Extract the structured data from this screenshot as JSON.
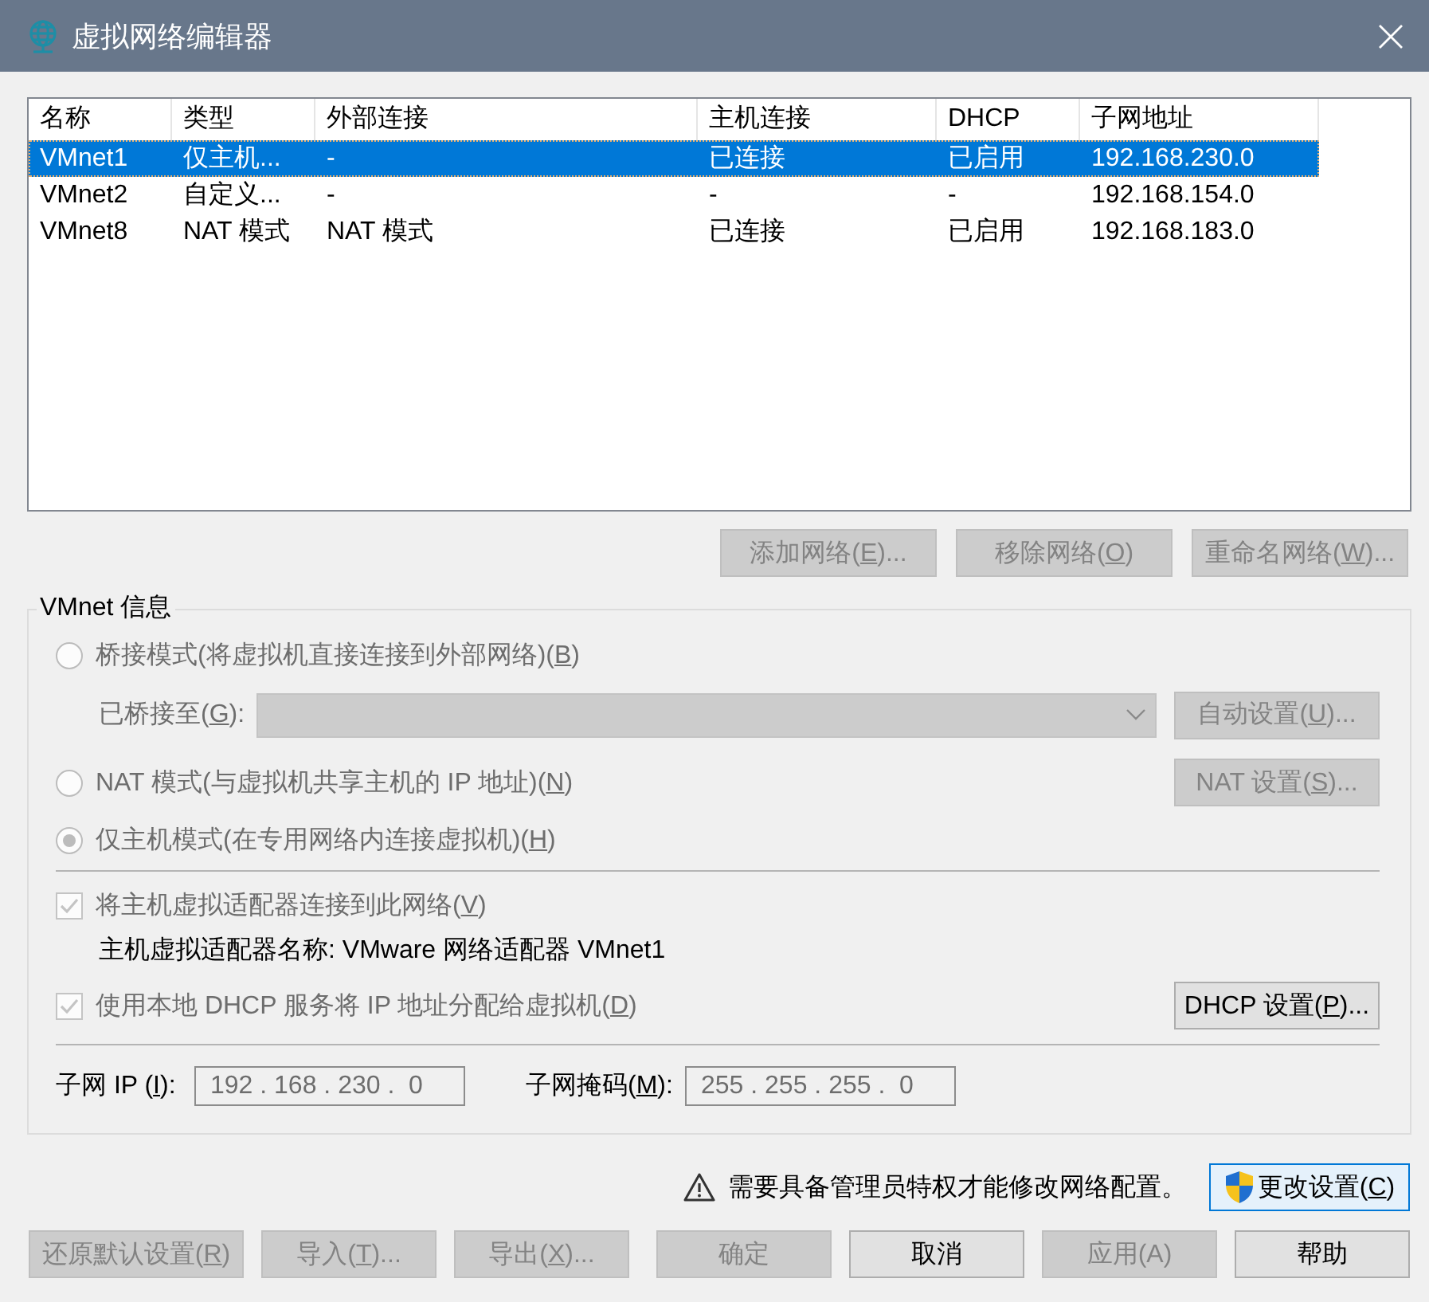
{
  "window": {
    "title": "虚拟网络编辑器"
  },
  "network_table": {
    "columns": [
      "名称",
      "类型",
      "外部连接",
      "主机连接",
      "DHCP",
      "子网地址"
    ],
    "rows": [
      {
        "cells": [
          "VMnet1",
          "仅主机...",
          "-",
          "已连接",
          "已启用",
          "192.168.230.0"
        ],
        "selected": true
      },
      {
        "cells": [
          "VMnet2",
          "自定义...",
          "-",
          "-",
          "-",
          "192.168.154.0"
        ],
        "selected": false
      },
      {
        "cells": [
          "VMnet8",
          "NAT 模式",
          "NAT 模式",
          "已连接",
          "已启用",
          "192.168.183.0"
        ],
        "selected": false
      }
    ]
  },
  "network_buttons": [
    {
      "label": "添加网络(",
      "access_key": "E",
      "label_end": ")...",
      "disabled": true
    },
    {
      "label": "移除网络(",
      "access_key": "O",
      "label_end": ")",
      "disabled": true
    },
    {
      "label": "重命名网络(",
      "access_key": "W",
      "label_end": ")...",
      "disabled": true
    }
  ],
  "vmnet_info": {
    "title": "VMnet 信息",
    "bridged_mode": {
      "label": "桥接模式(将虚拟机直接连接到外部网络)(",
      "access_key": "B",
      "label_end": ")",
      "selected": false,
      "disabled": true
    },
    "bridged_to": {
      "label": "已桥接至(",
      "access_key": "G",
      "label_end": "):",
      "disabled": true
    },
    "auto_settings_button": {
      "label": "自动设置(",
      "access_key": "U",
      "label_end": ")...",
      "disabled": true
    },
    "nat_mode": {
      "label": "NAT 模式(与虚拟机共享主机的 IP 地址)(",
      "access_key": "N",
      "label_end": ")",
      "selected": false,
      "disabled": true
    },
    "nat_settings_button": {
      "label": "NAT 设置(",
      "access_key": "S",
      "label_end": ")...",
      "disabled": true
    },
    "host_only_mode": {
      "label": "仅主机模式(在专用网络内连接虚拟机)(",
      "access_key": "H",
      "label_end": ")",
      "selected": true,
      "disabled": true
    },
    "connect_adapter": {
      "label": "将主机虚拟适配器连接到此网络(",
      "access_key": "V",
      "label_end": ")",
      "checked": true,
      "disabled": true
    },
    "adapter_name": "主机虚拟适配器名称: VMware 网络适配器 VMnet1",
    "use_dhcp": {
      "label": "使用本地 DHCP 服务将 IP 地址分配给虚拟机(",
      "access_key": "D",
      "label_end": ")",
      "checked": true,
      "disabled": true
    },
    "dhcp_settings_button": {
      "label": "DHCP 设置(",
      "access_key": "P",
      "label_end": ")...",
      "disabled": false
    },
    "subnet_ip": {
      "label": "子网 IP (",
      "access_key": "I",
      "label_end": "):",
      "value": "192 . 168 . 230 .  0",
      "disabled": true
    },
    "subnet_mask": {
      "label": "子网掩码(",
      "access_key": "M",
      "label_end": "):",
      "value": "255 . 255 . 255 .  0",
      "disabled": true
    }
  },
  "admin_notice": "需要具备管理员特权才能修改网络配置。",
  "change_settings_button": {
    "label": "更改设置(",
    "access_key": "C",
    "label_end": ")"
  },
  "footer_buttons_left": [
    {
      "label": "还原默认设置(",
      "access_key": "R",
      "label_end": ")",
      "disabled": true
    },
    {
      "label": "导入(",
      "access_key": "T",
      "label_end": ")...",
      "disabled": true
    },
    {
      "label": "导出(",
      "access_key": "X",
      "label_end": ")...",
      "disabled": true
    }
  ],
  "footer_buttons_right": [
    {
      "label": "确定",
      "disabled": true
    },
    {
      "label": "取消",
      "disabled": false
    },
    {
      "label": "应用(A)",
      "disabled": true
    },
    {
      "label": "帮助",
      "disabled": false
    }
  ]
}
